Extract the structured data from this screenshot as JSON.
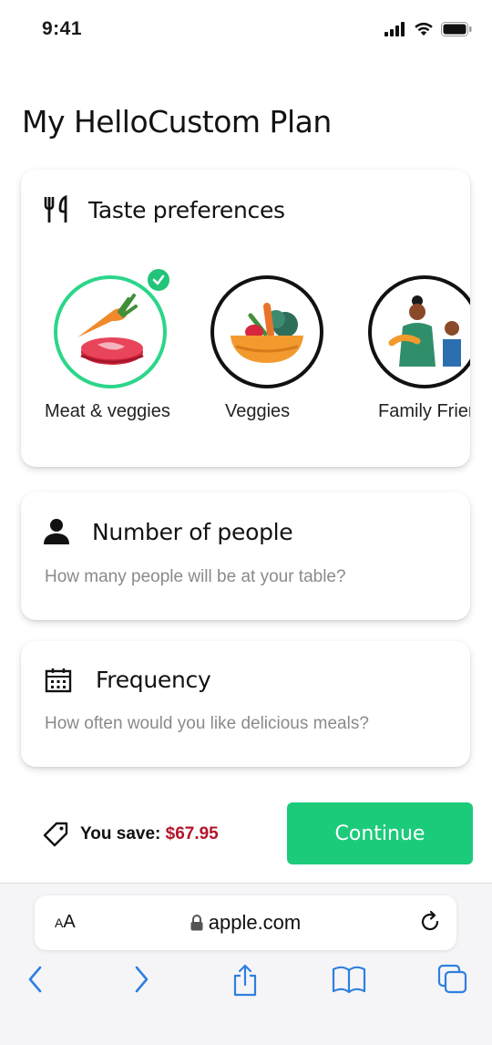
{
  "status": {
    "time": "9:41"
  },
  "page": {
    "title": "My HelloCustom Plan"
  },
  "taste": {
    "title": "Taste preferences",
    "options": [
      {
        "label": "Meat & veggies",
        "selected": true
      },
      {
        "label": "Veggies",
        "selected": false
      },
      {
        "label": "Family Friendly",
        "selected": false
      }
    ]
  },
  "people": {
    "title": "Number of people",
    "subtitle": "How many people will be at your table?"
  },
  "frequency": {
    "title": "Frequency",
    "subtitle": "How often would you like delicious meals?"
  },
  "footer": {
    "save_label": "You save:",
    "save_amount": "$67.95",
    "continue_label": "Continue"
  },
  "browser": {
    "aa_small": "A",
    "aa_large": "A",
    "url": "apple.com"
  },
  "colors": {
    "accent": "#1ccb7a",
    "selected_ring": "#2bd68a",
    "save_amount": "#b3152a",
    "ios_blue": "#2f7fe0"
  },
  "icons": [
    "fork-knife-icon",
    "person-icon",
    "calendar-icon",
    "price-tag-icon",
    "lock-icon",
    "reload-icon",
    "back-icon",
    "forward-icon",
    "share-icon",
    "bookmarks-icon",
    "tabs-icon",
    "checkmark-icon"
  ]
}
